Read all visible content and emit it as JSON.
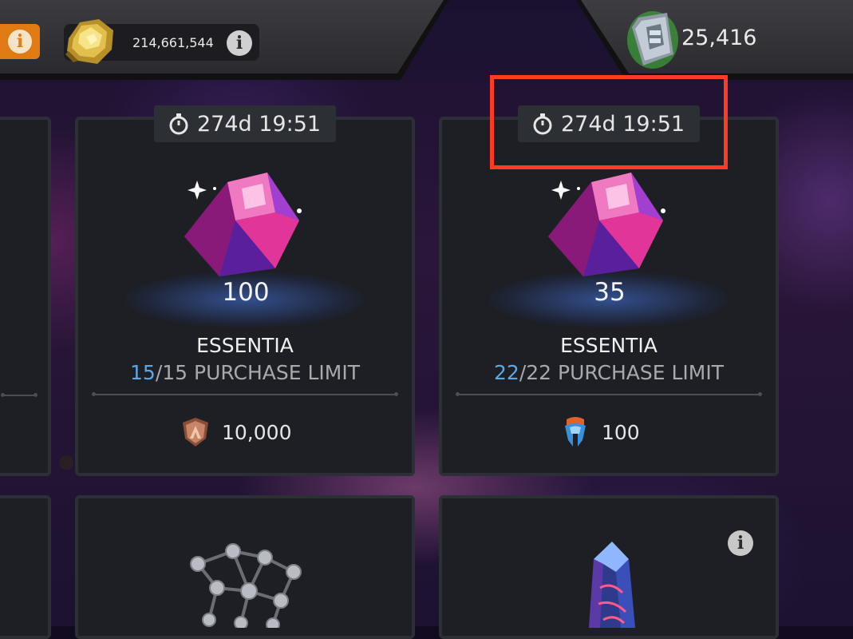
{
  "currency": {
    "gold_amount": "214,661,544",
    "units_amount": "25,416",
    "info_glyph": "i"
  },
  "cards": [
    {
      "timer": "274d 19:51",
      "quantity": "100",
      "title": "ESSENTIA",
      "limit_current": "15",
      "limit_text": "/15 PURCHASE LIMIT",
      "price": "10,000",
      "price_icon": "bronze-shield-icon"
    },
    {
      "timer": "274d 19:51",
      "quantity": "35",
      "title": "ESSENTIA",
      "limit_current": "22",
      "limit_text": "/22 PURCHASE LIMIT",
      "price": "100",
      "price_icon": "blue-token-icon"
    }
  ],
  "colors": {
    "highlight": "#ff3b24",
    "limit_current": "#5aa8e6",
    "info_orange": "#e07a12"
  }
}
